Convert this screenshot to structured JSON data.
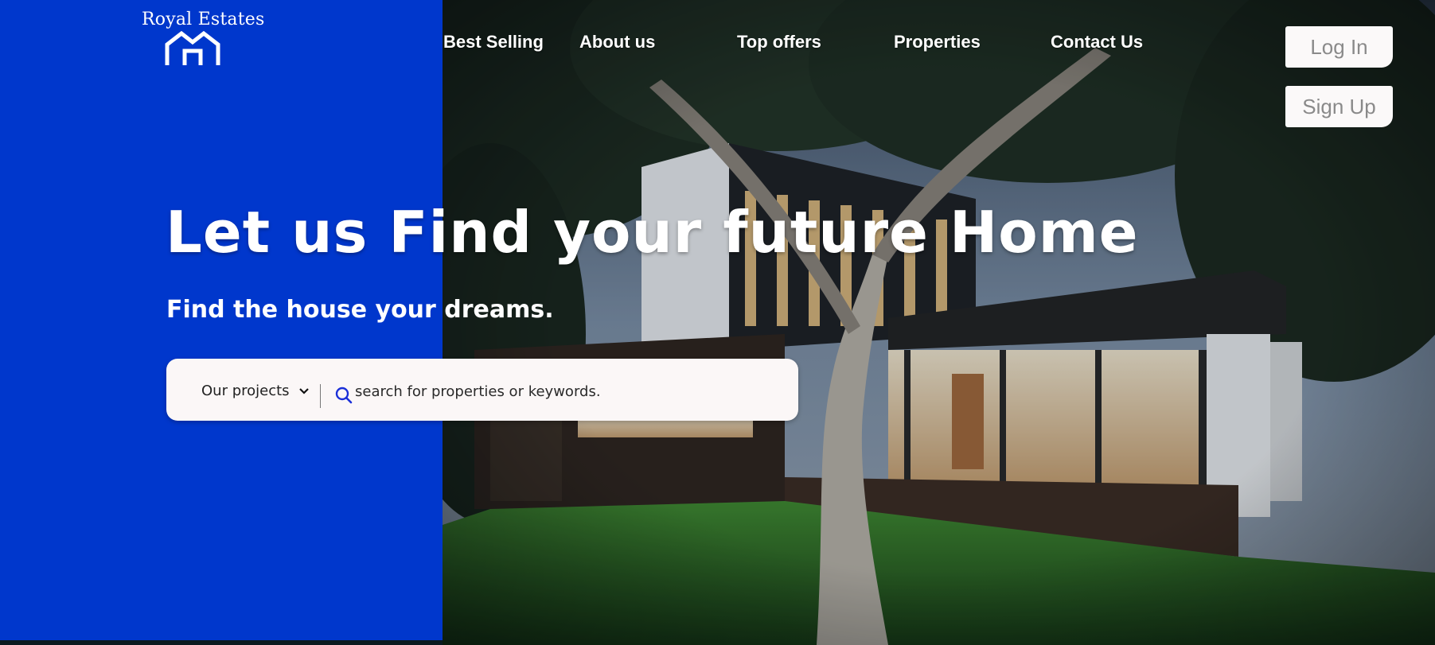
{
  "brand": {
    "name": "Royal Estates",
    "logo_icon": "house-outline-icon"
  },
  "nav": {
    "links": [
      "Best Selling",
      "About us",
      "Top offers",
      "Properties",
      "Contact Us"
    ]
  },
  "auth": {
    "login_label": "Log In",
    "signup_label": "Sign Up"
  },
  "hero": {
    "headline": "Let us Find your future Home",
    "subheadline": "Find the house your dreams."
  },
  "search": {
    "dropdown_label": "Our projects",
    "dropdown_icon": "chevron-down-icon",
    "search_icon": "search-icon",
    "placeholder": "search for properties or keywords."
  },
  "colors": {
    "brand_blue": "#0037cc",
    "text_white": "#ffffff",
    "search_bg": "#fbf7f7",
    "button_bg": "#fbf9f9",
    "button_text": "#8a8a8a",
    "search_icon_color": "#1a2fd8"
  }
}
